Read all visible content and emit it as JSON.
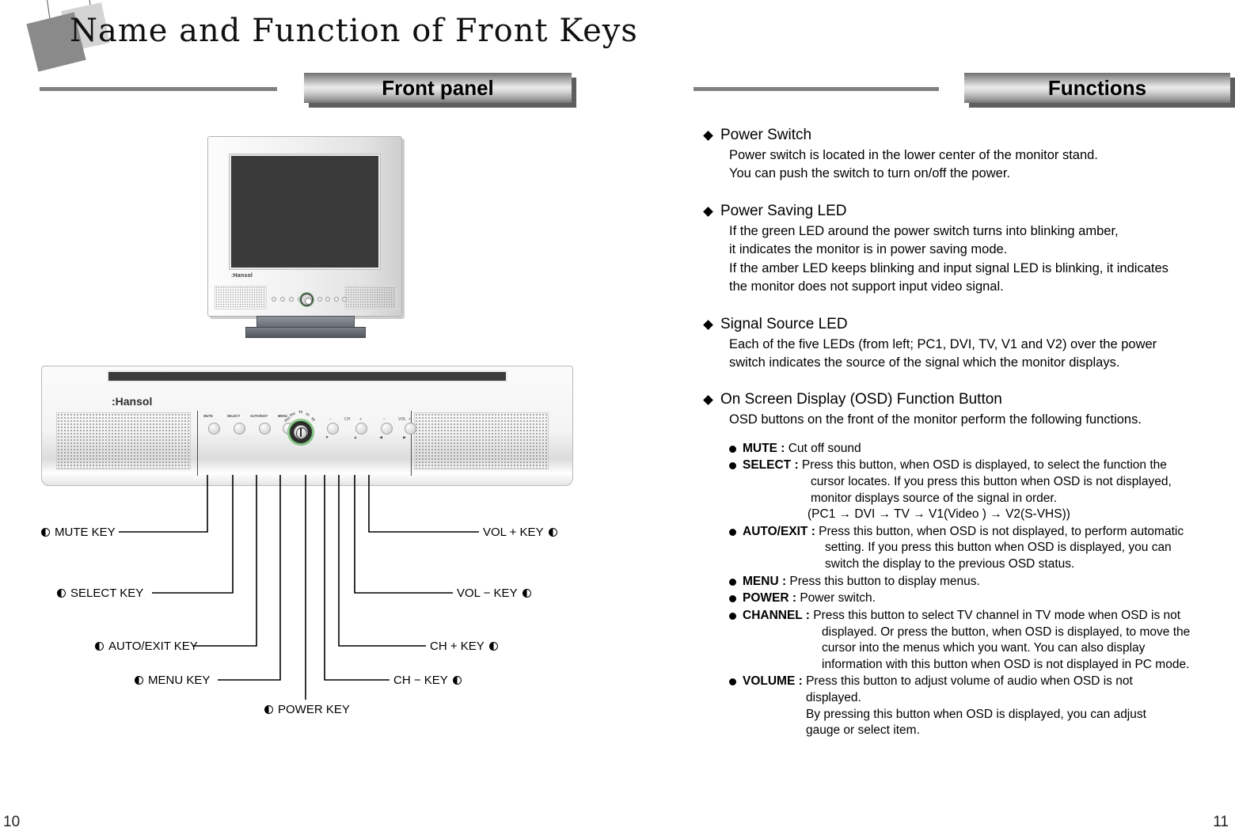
{
  "page": {
    "title": "Name and Function of Front Keys",
    "page_number_left": "10",
    "page_number_right": "11"
  },
  "banners": {
    "front_panel": "Front panel",
    "functions": "Functions"
  },
  "monitor": {
    "brand_logo": ":Hansol"
  },
  "panel": {
    "brand_logo": ":Hansol",
    "buttons": [
      {
        "cap": "MUTE",
        "sub": ""
      },
      {
        "cap": "SELECT",
        "sub": ""
      },
      {
        "cap": "AUTO/EXIT",
        "sub": ""
      },
      {
        "cap": "MENU",
        "sub": ""
      }
    ],
    "nav_buttons": [
      {
        "side": "−",
        "group": "CH",
        "sub": "▼"
      },
      {
        "side": "+",
        "group": "",
        "sub": "▲"
      },
      {
        "side": "−",
        "group": "VOL",
        "sub": "◀"
      },
      {
        "side": "+",
        "group": "",
        "sub": "▶"
      }
    ],
    "led_labels": [
      "PC1",
      "DVI",
      "TV",
      "V1",
      "V2"
    ]
  },
  "callouts": {
    "left": [
      {
        "label": "MUTE KEY"
      },
      {
        "label": "SELECT KEY"
      },
      {
        "label": "AUTO/EXIT  KEY"
      },
      {
        "label": "MENU KEY"
      },
      {
        "label": "POWER  KEY"
      }
    ],
    "right": [
      {
        "label": "VOL  +  KEY"
      },
      {
        "label": "VOL  −  KEY"
      },
      {
        "label": "CH + KEY"
      },
      {
        "label": "CH − KEY"
      }
    ]
  },
  "functions": {
    "sections": [
      {
        "title": "Power Switch",
        "lines": [
          "Power switch is located in the lower center of the monitor stand.",
          "You can push the switch to turn on/off the power."
        ]
      },
      {
        "title": "Power Saving LED",
        "lines": [
          "If the green LED around the power switch turns into blinking amber,",
          "it indicates the monitor is in power saving mode.",
          "If the amber LED keeps blinking and input signal LED is blinking, it indicates",
          "the monitor does not support input video signal."
        ]
      },
      {
        "title": "Signal Source LED",
        "lines": [
          "Each of the five LEDs (from left; PC1, DVI, TV, V1 and V2) over the power",
          "switch indicates the source of the signal which the monitor displays."
        ]
      },
      {
        "title": "On Screen Display (OSD) Function Button",
        "lines": [
          "OSD buttons on the front of the monitor perform the following functions."
        ]
      }
    ],
    "osd_items": [
      {
        "key": "MUTE :",
        "first": " Cut off sound",
        "cont": []
      },
      {
        "key": "SELECT :",
        "first": " Press this button, when OSD is displayed, to select the function the",
        "cont": [
          "cursor locates. If you press this button when OSD is not displayed,",
          "monitor displays source of the signal in order."
        ],
        "chain": "(PC1 → DVI → TV → V1(Video ) → V2(S-VHS))"
      },
      {
        "key": "AUTO/EXIT :",
        "first": " Press this button, when OSD is not displayed, to perform automatic",
        "cont": [
          "setting. If you press this button when OSD is displayed, you can",
          "switch the display to the previous OSD status."
        ]
      },
      {
        "key": "MENU :",
        "first": " Press this button to display menus.",
        "cont": []
      },
      {
        "key": "POWER :",
        "first": " Power switch.",
        "cont": []
      },
      {
        "key": "CHANNEL :",
        "first": " Press this button to select TV channel in TV mode when OSD is not",
        "cont": [
          "displayed. Or press the button, when OSD is displayed, to move the",
          "cursor into the menus which you want. You can also display",
          "information with this button when OSD is not displayed in PC mode."
        ]
      },
      {
        "key": "VOLUME :",
        "first": " Press this button to adjust volume of audio when OSD is not",
        "cont": [
          "displayed.",
          "By pressing this button when OSD is displayed, you can adjust",
          "gauge or select item."
        ]
      }
    ]
  },
  "colors": {
    "banner_dark": "#6e6e6e",
    "banner_light": "#ebebeb",
    "screen": "#3a3a3a",
    "led_green": "#6cc46c"
  }
}
